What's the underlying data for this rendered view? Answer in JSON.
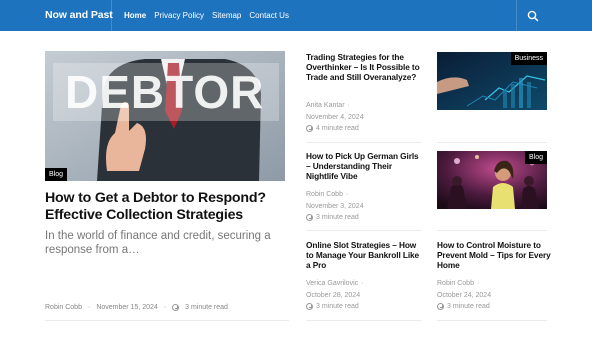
{
  "header": {
    "brand": "Now and Past",
    "nav": [
      "Home",
      "Privacy Policy",
      "Sitemap",
      "Contact Us"
    ]
  },
  "hero": {
    "image_text": "DEBTOR",
    "category": "Blog",
    "title": "How to Get a Debtor to Respond? Effective Collection Strategies",
    "excerpt": "In the world of finance and credit, securing a response from a…",
    "author": "Robin Cobb",
    "date": "November 15, 2024",
    "read_time": "3 minute read"
  },
  "articles": [
    {
      "title": "Trading Strategies for the Overthinker – Is It Possible to Trade and Still Overanalyze?",
      "author": "Anita Kantar",
      "date": "November 4, 2024",
      "read_time": "4 minute read"
    },
    {
      "category": "Business"
    },
    {
      "title": "How to Pick Up German Girls – Understanding Their Nightlife Vibe",
      "author": "Robin Cobb",
      "date": "November 3, 2024",
      "read_time": "3 minute read"
    },
    {
      "category": "Blog"
    },
    {
      "title": "Online Slot Strategies – How to Manage Your Bankroll Like a Pro",
      "author": "Verica Gavrilovic",
      "date": "October 28, 2024",
      "read_time": "3 minute read"
    },
    {
      "title": "How to Control Moisture to Prevent Mold – Tips for Every Home",
      "author": "Robin Cobb",
      "date": "October 24, 2024",
      "read_time": "3 minute read"
    }
  ],
  "meta_separator": "·",
  "colors": {
    "header_bg": "#1e73be",
    "badge_bg": "#000000",
    "meta_text": "#999999"
  }
}
